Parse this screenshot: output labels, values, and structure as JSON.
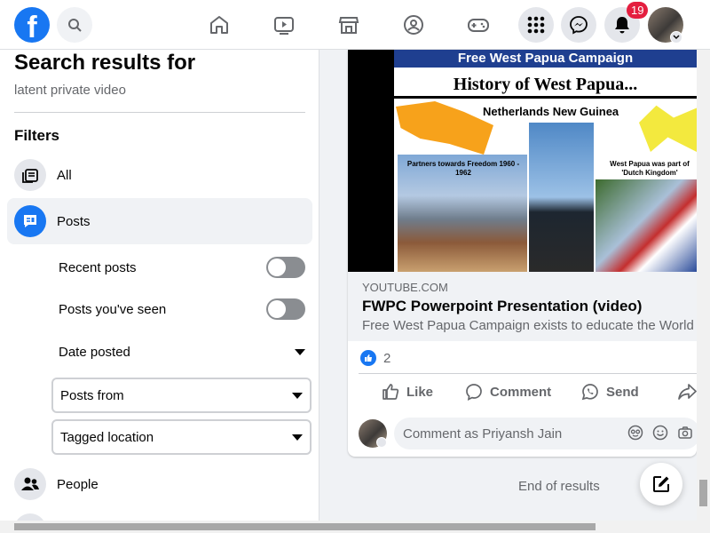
{
  "topbar": {
    "logo": "f",
    "notification_count": "19",
    "icons": [
      "home-icon",
      "watch-icon",
      "marketplace-icon",
      "groups-icon",
      "gaming-icon",
      "menu-grid-icon",
      "messenger-icon",
      "bell-icon"
    ]
  },
  "search": {
    "heading": "Search results for",
    "query": "latent private video",
    "filters_heading": "Filters"
  },
  "filters": {
    "all": "All",
    "posts": "Posts",
    "recent_posts": "Recent posts",
    "posts_seen": "Posts you've seen",
    "date_posted": "Date posted",
    "posts_from": "Posts from",
    "tagged_location": "Tagged location",
    "people": "People"
  },
  "post": {
    "slide_banner": "Free West Papua Campaign",
    "slide_title": "History of West Papua...",
    "slide_subtitle": "Netherlands New Guinea",
    "slide_caption_left": "Partners towards Freedom 1960 - 1962",
    "slide_caption_right": "West Papua was part of 'Dutch Kingdom'",
    "domain": "YOUTUBE.COM",
    "title": "FWPC Powerpoint Presentation (video)",
    "description": "Free West Papua Campaign exists to educate the World",
    "reaction_count": "2",
    "like": "Like",
    "comment": "Comment",
    "send": "Send",
    "comment_placeholder": "Comment as Priyansh Jain"
  },
  "feed": {
    "end_text": "End of results"
  },
  "colors": {
    "brand": "#1877f2",
    "badge": "#e41e3f"
  }
}
